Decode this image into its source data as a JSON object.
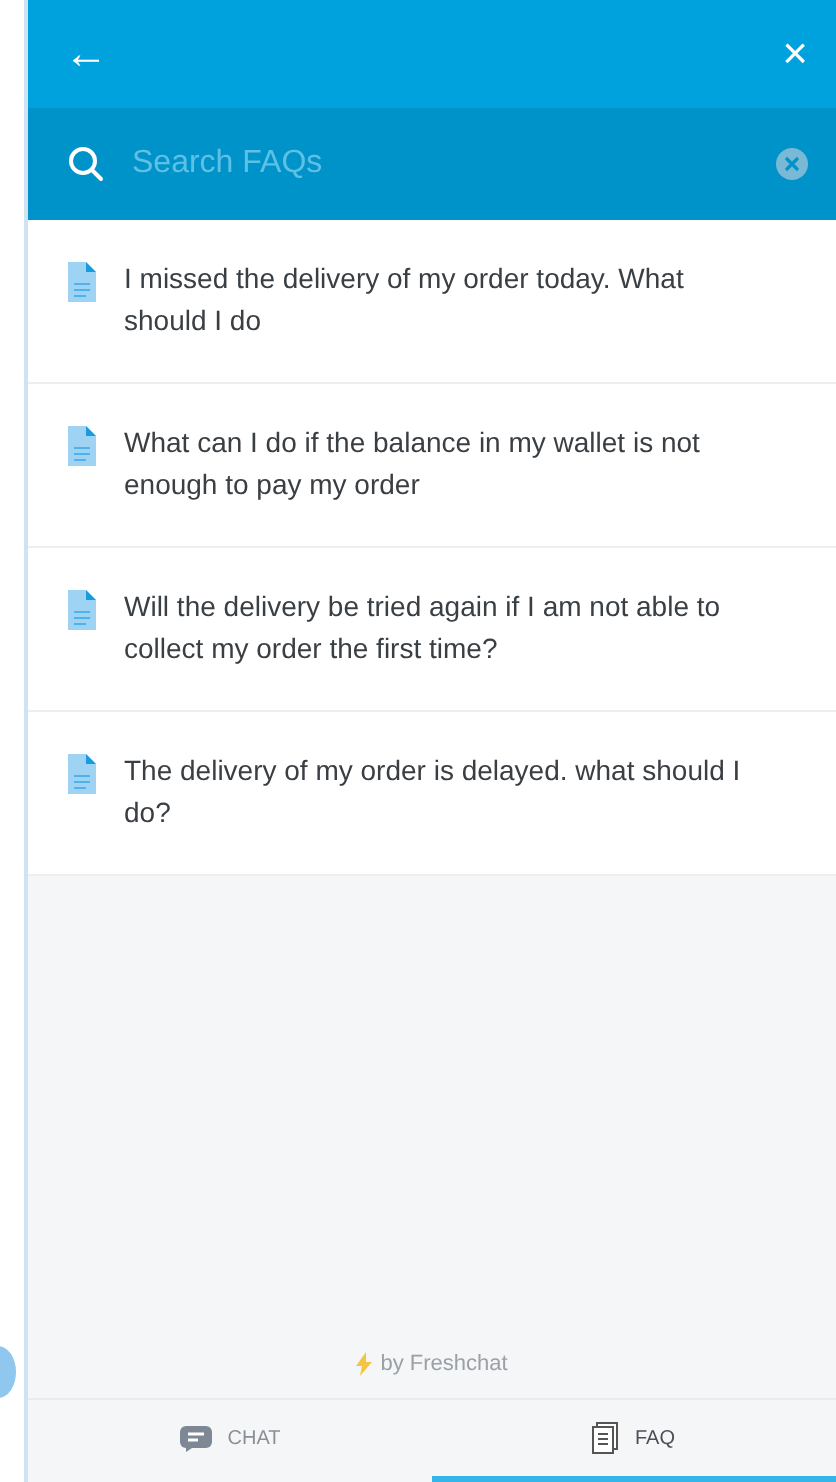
{
  "header": {
    "back": "←",
    "close": "×"
  },
  "search": {
    "placeholder": "Search FAQs"
  },
  "faqs": [
    {
      "question": "I missed the delivery of my order today. What should I do"
    },
    {
      "question": "What can I do if the balance in my wallet is not enough to pay my order"
    },
    {
      "question": "Will the delivery be tried again if I am not able to collect my order the first time?"
    },
    {
      "question": "The delivery of my order is delayed. what should I do?"
    }
  ],
  "branding": "by Freshchat",
  "tabs": [
    {
      "label": "CHAT",
      "kind": "chat",
      "selected": false
    },
    {
      "label": "FAQ",
      "kind": "faq",
      "selected": true
    }
  ]
}
